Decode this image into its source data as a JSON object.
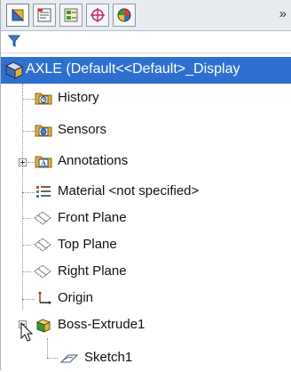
{
  "toolbar": {
    "tabs": [
      {
        "icon": "feature-manager-icon"
      },
      {
        "icon": "property-manager-icon"
      },
      {
        "icon": "configuration-manager-icon"
      },
      {
        "icon": "dimxpert-manager-icon"
      },
      {
        "icon": "display-manager-icon"
      }
    ],
    "more_label": "»"
  },
  "filter": {
    "icon": "filter-icon"
  },
  "tree": {
    "root_label": "AXLE  (Default<<Default>_Display",
    "items": [
      {
        "label": "History",
        "icon": "history-folder-icon"
      },
      {
        "label": "Sensors",
        "icon": "sensors-folder-icon"
      },
      {
        "label": "Annotations",
        "icon": "annotations-folder-icon"
      },
      {
        "label": "Material <not specified>",
        "icon": "material-icon"
      },
      {
        "label": "Front Plane",
        "icon": "plane-icon"
      },
      {
        "label": "Top Plane",
        "icon": "plane-icon"
      },
      {
        "label": "Right Plane",
        "icon": "plane-icon"
      },
      {
        "label": "Origin",
        "icon": "origin-icon"
      },
      {
        "label": "Boss-Extrude1",
        "icon": "boss-extrude-icon"
      },
      {
        "label": "Sketch1",
        "icon": "sketch-icon"
      }
    ]
  },
  "colors": {
    "selection": "#2f6fcf",
    "folder": "#e3b23c"
  }
}
